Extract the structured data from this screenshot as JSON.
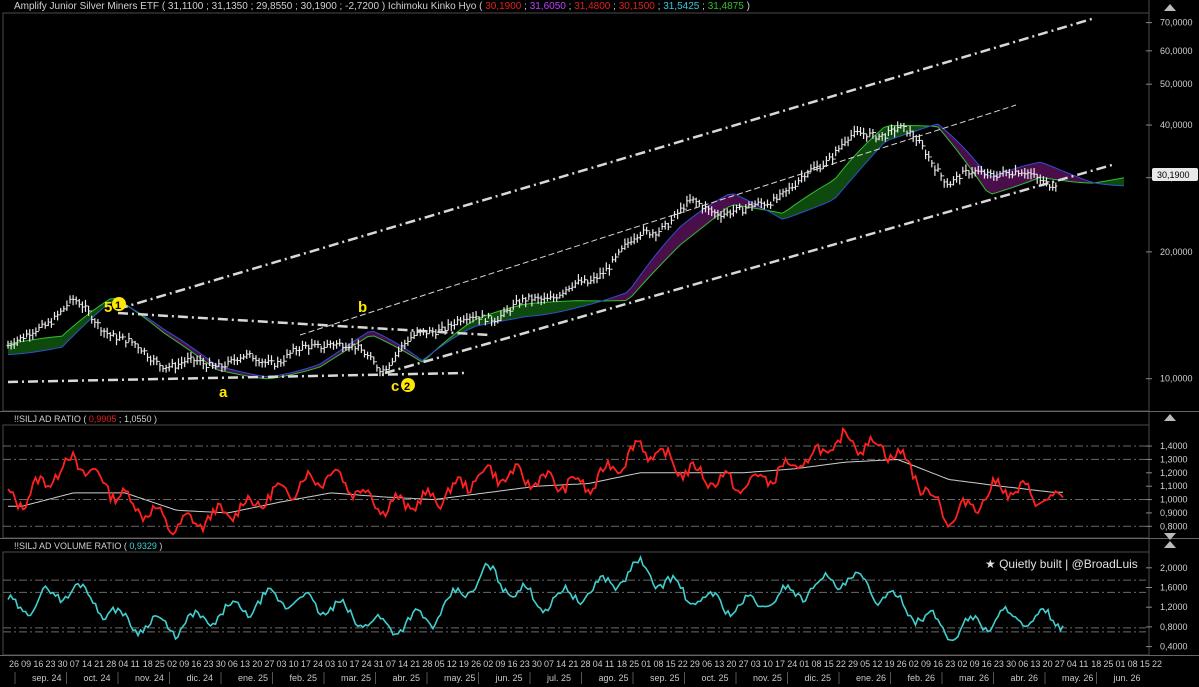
{
  "panels": {
    "price": {
      "symbol_name": "Amplify Junior Silver Miners ETF",
      "ohlc_values": "31,1100 ; 31,1350 ; 29,8550 ; 30,1900 ; -2,7200",
      "ichimoku_name": "Ichimoku Kinko Hyo",
      "ichimoku_values": [
        {
          "text": "30,1900",
          "color": "#e02020"
        },
        {
          "text": "31,6050",
          "color": "#c040ff"
        },
        {
          "text": "31,4800",
          "color": "#e02020"
        },
        {
          "text": "30,1500",
          "color": "#e02020"
        },
        {
          "text": "31,5425",
          "color": "#38c8e0"
        },
        {
          "text": "31,4875",
          "color": "#30c030"
        }
      ],
      "last_price_badge": "30,1900",
      "y_ticks": [
        "70,0000",
        "60,0000",
        "50,0000",
        "40,0000",
        "30,0000",
        "20,0000",
        "10,0000"
      ],
      "annotations": {
        "wave_5": "5",
        "wave_1": "1",
        "wave_a": "a",
        "wave_b": "b",
        "wave_c": "c",
        "wave_2": "2"
      }
    },
    "ad_ratio": {
      "name": "!!SILJ AD RATIO",
      "value_1": "0,9905",
      "value_2": "1,0550",
      "y_ticks": [
        "1,4000",
        "1,3000",
        "1,2000",
        "1,1000",
        "1,0000",
        "0,9000",
        "0,8000"
      ]
    },
    "ad_volume": {
      "name": "!!SILJ AD VOLUME RATIO",
      "value": "0,9329",
      "watermark": "Quietly built | @BroadLuis",
      "y_ticks": [
        "2,0000",
        "1,6000",
        "1,2000",
        "0,8000",
        "0,4000"
      ]
    }
  },
  "x_axis": {
    "day_labels": [
      "26",
      "09",
      "16",
      "23",
      "30",
      "07",
      "14",
      "21",
      "28",
      "04",
      "11",
      "18",
      "25",
      "02",
      "09",
      "16",
      "23",
      "30",
      "06",
      "13",
      "20",
      "27",
      "03",
      "10",
      "17",
      "24",
      "03",
      "10",
      "17",
      "24",
      "31",
      "07",
      "14",
      "21",
      "28",
      "05",
      "12",
      "19",
      "26",
      "02",
      "09",
      "16",
      "23",
      "30",
      "07",
      "14",
      "21",
      "28",
      "04",
      "11",
      "18",
      "25",
      "01",
      "08",
      "15",
      "22",
      "29",
      "06",
      "13",
      "20",
      "27",
      "03",
      "10",
      "17",
      "24",
      "01",
      "08",
      "15",
      "22",
      "29",
      "05",
      "12",
      "19",
      "26",
      "02",
      "09",
      "16",
      "23",
      "02",
      "09",
      "16",
      "23",
      "30",
      "06",
      "13",
      "20",
      "27",
      "04",
      "11",
      "18",
      "25",
      "01",
      "08",
      "15",
      "22"
    ],
    "month_labels": [
      "sep. 24",
      "oct. 24",
      "nov. 24",
      "dic. 24",
      "ene. 25",
      "feb. 25",
      "mar. 25",
      "abr. 25",
      "may. 25",
      "jun. 25",
      "jul. 25",
      "ago. 25",
      "sep. 25",
      "oct. 25",
      "nov. 25",
      "dic. 25",
      "ene. 26",
      "feb. 26",
      "mar. 26",
      "abr. 26",
      "may. 26",
      "jun. 26"
    ]
  },
  "colors": {
    "up_cloud": "#0e4a0e",
    "down_cloud": "#4a0e4a",
    "ad_line": "#ff2020",
    "vol_line": "#40d0d0",
    "panel_bg": "#000000",
    "grid": "#303030"
  },
  "chart_data": [
    {
      "type": "line",
      "title": "Amplify Junior Silver Miners ETF",
      "scale": "log",
      "ylim": [
        9,
        75
      ],
      "x": [
        "sep. 24",
        "oct. 24",
        "nov. 24",
        "dic. 24",
        "ene. 25",
        "feb. 25",
        "mar. 25",
        "abr. 25",
        "may. 25",
        "jun. 25",
        "jul. 25",
        "ago. 25",
        "sep. 25",
        "oct. 25",
        "nov. 25",
        "dic. 25",
        "ene. 26",
        "feb. 26",
        "mar. 26",
        "abr. 26",
        "may. 26"
      ],
      "series": [
        {
          "values": [
            12.0,
            14.8,
            12.5,
            10.8,
            10.6,
            11.2,
            12.8,
            10.5,
            13.0,
            14.5,
            15.5,
            16.2,
            22.0,
            26.5,
            24.0,
            28.0,
            38.0,
            39.5,
            28.5,
            32.0,
            30.19
          ]
        }
      ]
    },
    {
      "type": "line",
      "title": "!!SILJ AD RATIO",
      "ylim": [
        0.75,
        1.55
      ],
      "x": [
        "sep. 24",
        "oct. 24",
        "nov. 24",
        "dic. 24",
        "ene. 25",
        "feb. 25",
        "mar. 25",
        "abr. 25",
        "may. 25",
        "jun. 25",
        "jul. 25",
        "ago. 25",
        "sep. 25",
        "oct. 25",
        "nov. 25",
        "dic. 25",
        "ene. 26",
        "feb. 26",
        "mar. 26",
        "abr. 26",
        "may. 26"
      ],
      "series": [
        {
          "values": [
            1.0,
            1.3,
            1.0,
            0.8,
            0.9,
            1.05,
            1.2,
            0.95,
            1.0,
            1.2,
            1.15,
            1.1,
            1.4,
            1.2,
            1.1,
            1.25,
            1.45,
            1.35,
            0.85,
            1.1,
            0.99
          ]
        },
        {
          "values": [
            0.95,
            1.05,
            1.05,
            0.92,
            0.9,
            0.98,
            1.05,
            1.02,
            1.0,
            1.05,
            1.1,
            1.12,
            1.2,
            1.2,
            1.2,
            1.23,
            1.28,
            1.3,
            1.15,
            1.1,
            1.055
          ]
        }
      ]
    },
    {
      "type": "line",
      "title": "!!SILJ AD VOLUME RATIO",
      "ylim": [
        0.3,
        2.3
      ],
      "x": [
        "sep. 24",
        "oct. 24",
        "nov. 24",
        "dic. 24",
        "ene. 25",
        "feb. 25",
        "mar. 25",
        "abr. 25",
        "may. 25",
        "jun. 25",
        "jul. 25",
        "ago. 25",
        "sep. 25",
        "oct. 25",
        "nov. 25",
        "dic. 25",
        "ene. 26",
        "feb. 26",
        "mar. 26",
        "abr. 26",
        "may. 26"
      ],
      "series": [
        {
          "values": [
            1.2,
            1.6,
            0.9,
            0.8,
            1.1,
            1.4,
            1.2,
            0.8,
            1.0,
            1.9,
            1.3,
            1.5,
            2.0,
            1.4,
            1.2,
            1.5,
            1.8,
            1.3,
            0.7,
            1.0,
            0.93
          ]
        }
      ]
    }
  ]
}
